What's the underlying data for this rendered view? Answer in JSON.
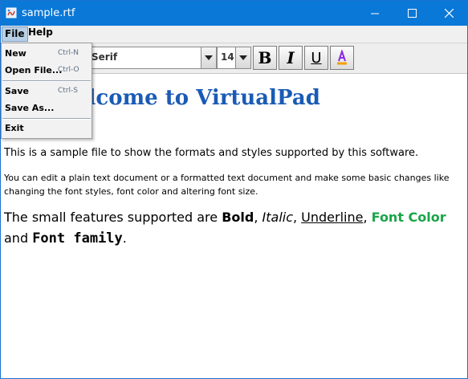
{
  "window": {
    "title": "sample.rtf",
    "titlebar_color": "#0a78d7",
    "controls": [
      "minimize-icon",
      "maximize-icon",
      "close-icon"
    ]
  },
  "menubar": {
    "file": "File",
    "help": "Help"
  },
  "file_menu": {
    "items": [
      {
        "label": "New",
        "shortcut": "Ctrl-N"
      },
      {
        "label": "Open File...",
        "shortcut": "Ctrl-O"
      },
      {
        "label": "Save",
        "shortcut": "Ctrl-S"
      },
      {
        "label": "Save As...",
        "shortcut": ""
      },
      {
        "label": "Exit",
        "shortcut": ""
      }
    ]
  },
  "toolbar": {
    "font_family": "Serif",
    "font_size": "14",
    "bold_label": "B",
    "italic_label": "I",
    "underline_label": "U",
    "font_color_icon": "font-color-icon",
    "font_color_accent": "#8a2be2"
  },
  "document": {
    "heading": "elcome to VirtualPad",
    "heading_color": "#1a5bb5",
    "para1": "This is a sample file to show the formats and styles supported by this software.",
    "para2": "You can edit a plain text document or a formatted text document and make some basic changes like changing the font styles, font color and altering font size.",
    "para3": {
      "intro": "The small features supported are ",
      "bold": "Bold",
      "sep1": ", ",
      "italic": "Italic",
      "sep2": ", ",
      "underline": "Underline",
      "sep3": ", ",
      "font_color": "Font Color",
      "font_color_value": "#1aa54a",
      "sep4": " and ",
      "font_family": "Font family",
      "end": "."
    }
  }
}
